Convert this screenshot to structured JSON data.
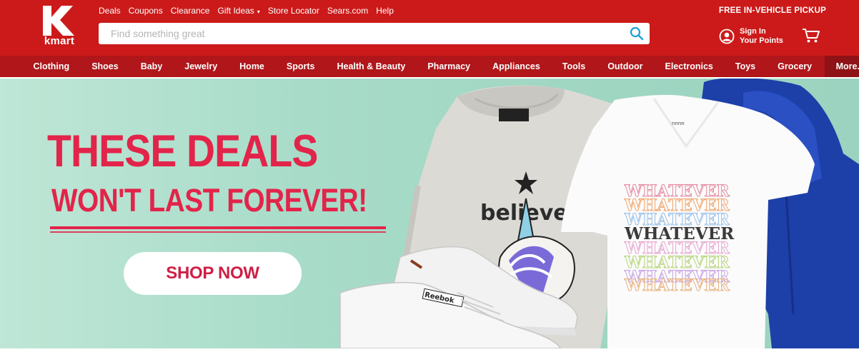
{
  "brand": {
    "logo_letter": "K",
    "logo_word": "kmart",
    "color": "#cc1a1a"
  },
  "top_links": [
    {
      "label": "Deals"
    },
    {
      "label": "Coupons"
    },
    {
      "label": "Clearance"
    },
    {
      "label": "Gift Ideas"
    },
    {
      "label": "Store Locator"
    },
    {
      "label": "Sears.com"
    },
    {
      "label": "Help"
    }
  ],
  "promo_text": "FREE IN-VEHICLE PICKUP",
  "search": {
    "placeholder": "Find something great",
    "value": "",
    "icon": "search-icon"
  },
  "account": {
    "line1": "Sign In",
    "line2": "Your Points",
    "icon": "user-icon"
  },
  "cart": {
    "icon": "cart-icon"
  },
  "nav": [
    {
      "label": "Clothing"
    },
    {
      "label": "Shoes"
    },
    {
      "label": "Baby"
    },
    {
      "label": "Jewelry"
    },
    {
      "label": "Home"
    },
    {
      "label": "Sports"
    },
    {
      "label": "Health & Beauty"
    },
    {
      "label": "Pharmacy"
    },
    {
      "label": "Appliances"
    },
    {
      "label": "Tools"
    },
    {
      "label": "Outdoor"
    },
    {
      "label": "Electronics"
    },
    {
      "label": "Toys"
    },
    {
      "label": "Grocery"
    },
    {
      "label": "More..."
    }
  ],
  "hero": {
    "headline1": "THESE DEALS",
    "headline2": "WON'T LAST FOREVER!",
    "cta": "SHOP NOW",
    "sweatshirt_text": "believe",
    "tshirt_word": "WHATEVER",
    "shoe_brand": "Reebok",
    "accent_color": "#e3244a",
    "background_color": "#a8dcc9"
  }
}
